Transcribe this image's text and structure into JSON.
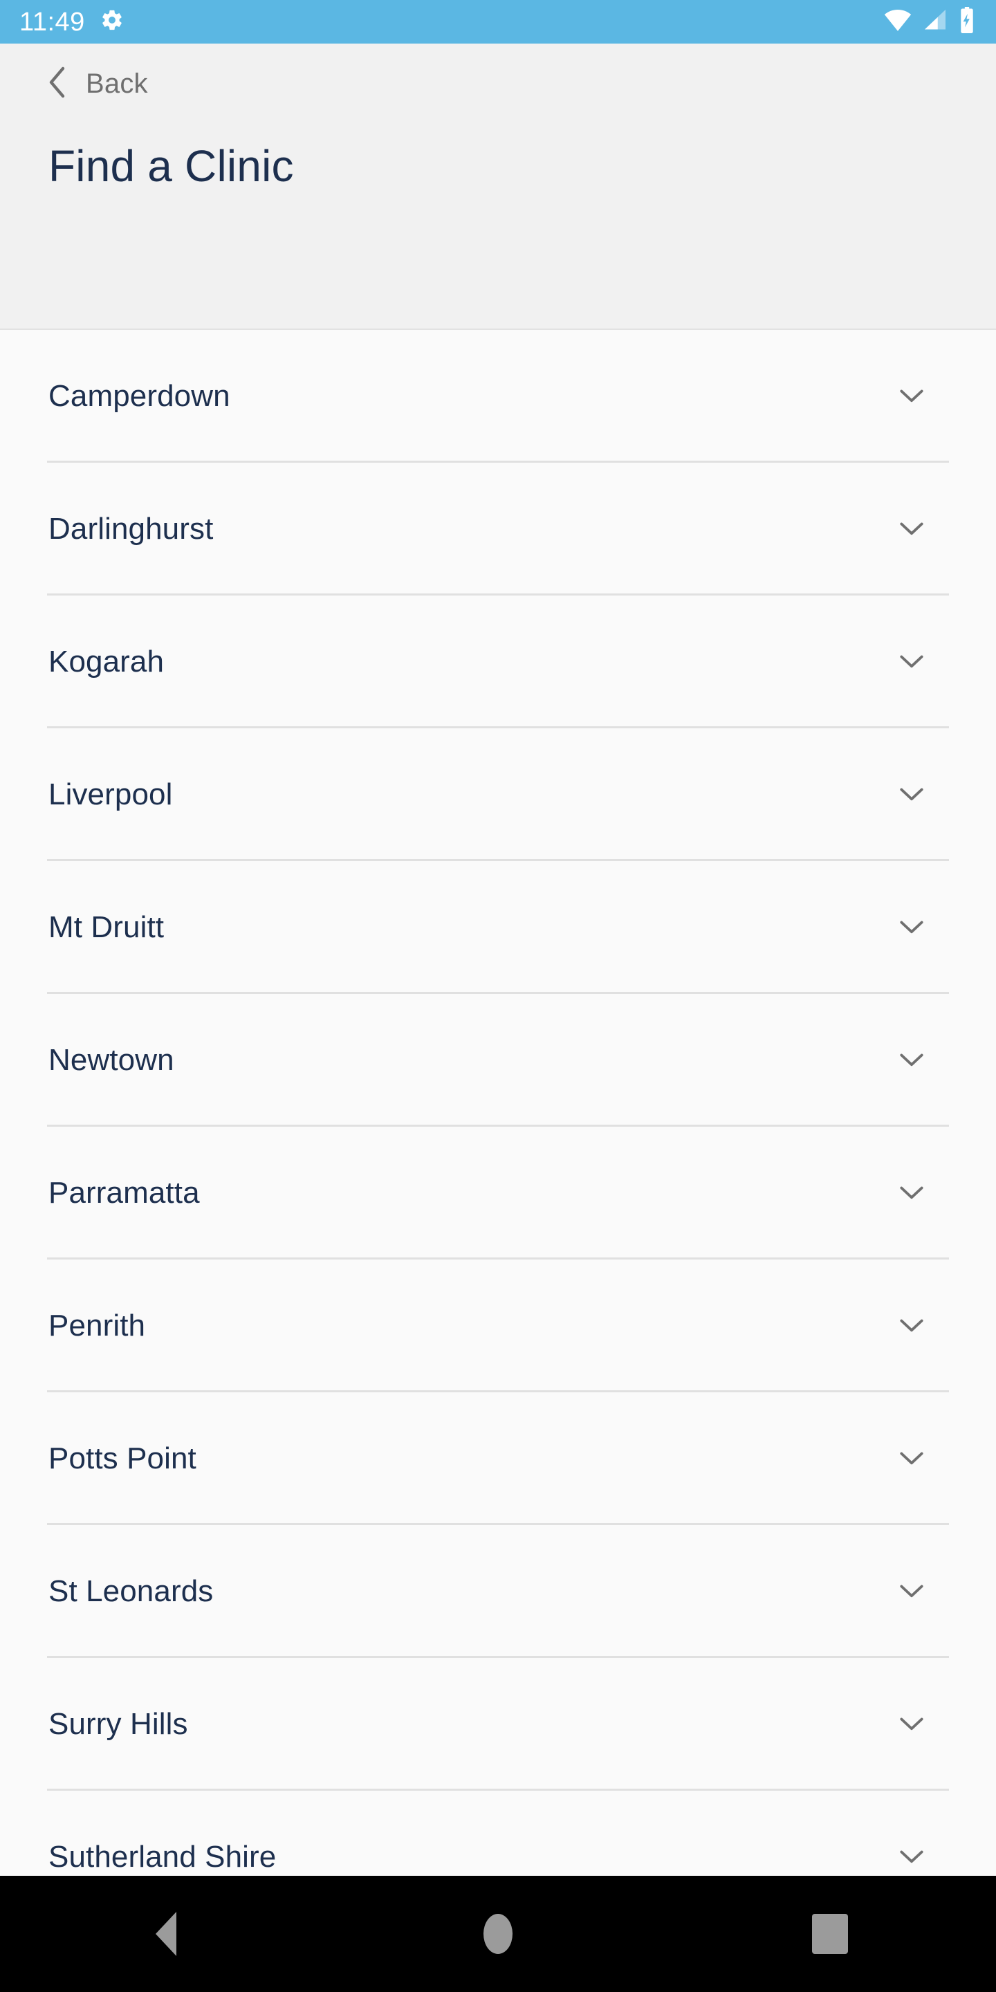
{
  "status_bar": {
    "time": "11:49",
    "background_color": "#5bb7e3",
    "icons": {
      "settings": "gear-icon",
      "wifi": "wifi-icon",
      "signal": "cell-signal-icon",
      "battery": "battery-charging-icon"
    }
  },
  "header": {
    "back_label": "Back",
    "back_icon": "chevron-left-icon",
    "title": "Find a Clinic",
    "title_color": "#1d2f4e",
    "background_color": "#f1f1f1"
  },
  "clinic_list": {
    "expand_icon": "chevron-down-icon",
    "items": [
      {
        "label": "Camperdown"
      },
      {
        "label": "Darlinghurst"
      },
      {
        "label": "Kogarah"
      },
      {
        "label": "Liverpool"
      },
      {
        "label": "Mt Druitt"
      },
      {
        "label": "Newtown"
      },
      {
        "label": "Parramatta"
      },
      {
        "label": "Penrith"
      },
      {
        "label": "Potts Point"
      },
      {
        "label": "St Leonards"
      },
      {
        "label": "Surry Hills"
      },
      {
        "label": "Sutherland Shire"
      }
    ]
  },
  "nav_bar": {
    "background_color": "#000000",
    "icon_color": "#9b9b9b",
    "buttons": [
      {
        "name": "back",
        "icon": "triangle-back-icon"
      },
      {
        "name": "home",
        "icon": "circle-home-icon"
      },
      {
        "name": "recents",
        "icon": "square-recents-icon"
      }
    ]
  }
}
